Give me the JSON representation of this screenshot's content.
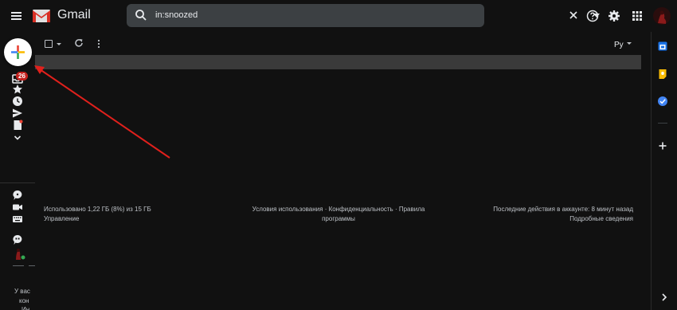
{
  "header": {
    "brand": "Gmail",
    "search_query": "in:snoozed"
  },
  "sidebar": {
    "inbox_badge": "26",
    "cut_text": [
      "У вас",
      "кон",
      "Ин"
    ]
  },
  "toolbar": {
    "lang_label": "Ру"
  },
  "footer": {
    "storage_line1": "Использовано 1,22 ГБ (8%) из 15 ГБ",
    "storage_line2": "Управление",
    "terms_line1": "Условия использования · Конфиденциальность · Правила",
    "terms_line2": "программы",
    "activity_line1": "Последние действия в аккаунте: 8 минут назад",
    "activity_line2": "Подробные сведения"
  },
  "colors": {
    "background": "#111111",
    "search_bg": "#3c4043",
    "badge": "#c5221f",
    "annotation_arrow": "#e0201c"
  },
  "icons": [
    "menu-icon",
    "gmail-logo",
    "search-icon",
    "clear-icon",
    "search-options-icon",
    "help-icon",
    "settings-icon",
    "apps-icon",
    "compose-plus-icon",
    "inbox-icon",
    "star-icon",
    "snoozed-clock-icon",
    "sent-icon",
    "drafts-icon",
    "more-chevron-icon",
    "chat-icon",
    "video-icon",
    "keyboard-icon",
    "hangouts-icon",
    "calendar-icon",
    "keep-icon",
    "tasks-icon",
    "add-addon-icon",
    "expand-panel-icon"
  ]
}
